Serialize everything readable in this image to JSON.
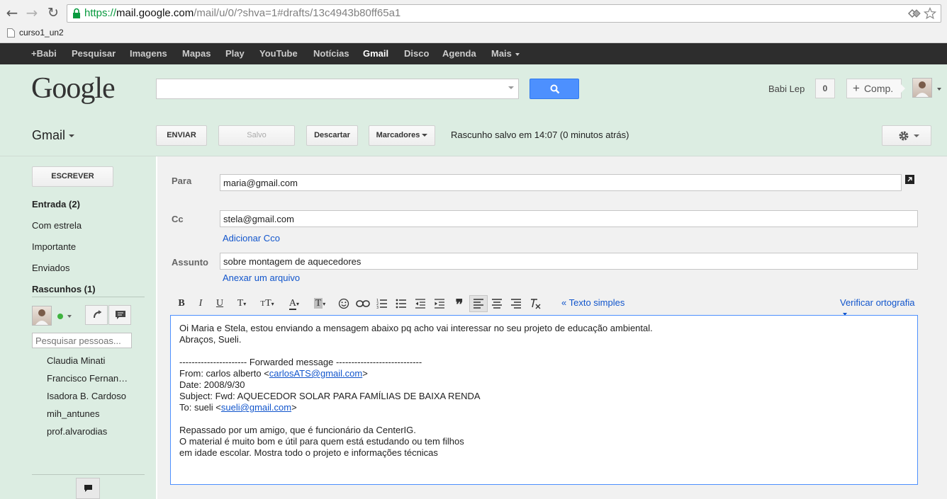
{
  "browser": {
    "url_protocol": "https://",
    "url_host": "mail.google.com",
    "url_path": "/mail/u/0/?shva=1#drafts/13c4943b80ff65a1",
    "bookmark": "curso1_un2"
  },
  "gbar": {
    "items": [
      "+Babi",
      "Pesquisar",
      "Imagens",
      "Mapas",
      "Play",
      "YouTube",
      "Notícias",
      "Gmail",
      "Disco",
      "Agenda",
      "Mais"
    ]
  },
  "header": {
    "logo": "Google",
    "user": "Babi Lep",
    "notifications": "0",
    "share_label": "Comp."
  },
  "actionbar": {
    "app_label": "Gmail",
    "send": "ENVIAR",
    "saved": "Salvo",
    "discard": "Descartar",
    "labels": "Marcadores",
    "status": "Rascunho salvo em 14:07 (0 minutos atrás)"
  },
  "sidebar": {
    "compose": "ESCREVER",
    "items": [
      "Entrada (2)",
      "Com estrela",
      "Importante",
      "Enviados",
      "Rascunhos (1)"
    ],
    "people_search_placeholder": "Pesquisar pessoas...",
    "contacts": [
      "Claudia Minati",
      "Francisco Fernan…",
      "Isadora B. Cardoso",
      "mih_antunes",
      "prof.alvarodias"
    ]
  },
  "compose": {
    "to_label": "Para",
    "to_value": "maria@gmail.com",
    "cc_label": "Cc",
    "cc_value": "stela@gmail.com",
    "add_bcc": "Adicionar Cco",
    "subject_label": "Assunto",
    "subject_value": "sobre montagem de aquecedores",
    "attach": "Anexar um arquivo",
    "plain_text": "« Texto simples",
    "spellcheck": "Verificar ortografia",
    "body": {
      "line1": "Oi Maria e Stela, estou enviando a mensagem abaixo pq acho vai interessar no seu projeto de educação ambiental.",
      "line2": "Abraços, Sueli.",
      "fwd_header": "---------------------- Forwarded message ----------------------------",
      "from_prefix": "From: carlos alberto <",
      "from_email": "carlosATS@gmail.com",
      "from_suffix": ">",
      "date": "Date: 2008/9/30",
      "subject": "Subject: Fwd: AQUECEDOR SOLAR PARA FAMÍLIAS DE BAIXA RENDA",
      "to_prefix": "To: sueli <",
      "to_email": "sueli@gmail.com",
      "to_suffix": ">",
      "p1": "Repassado por um amigo, que é funcionário da CenterIG.",
      "p2": "O material é muito bom e útil para quem está estudando ou tem filhos",
      "p3": "em idade escolar. Mostra todo o projeto e informações técnicas"
    }
  }
}
